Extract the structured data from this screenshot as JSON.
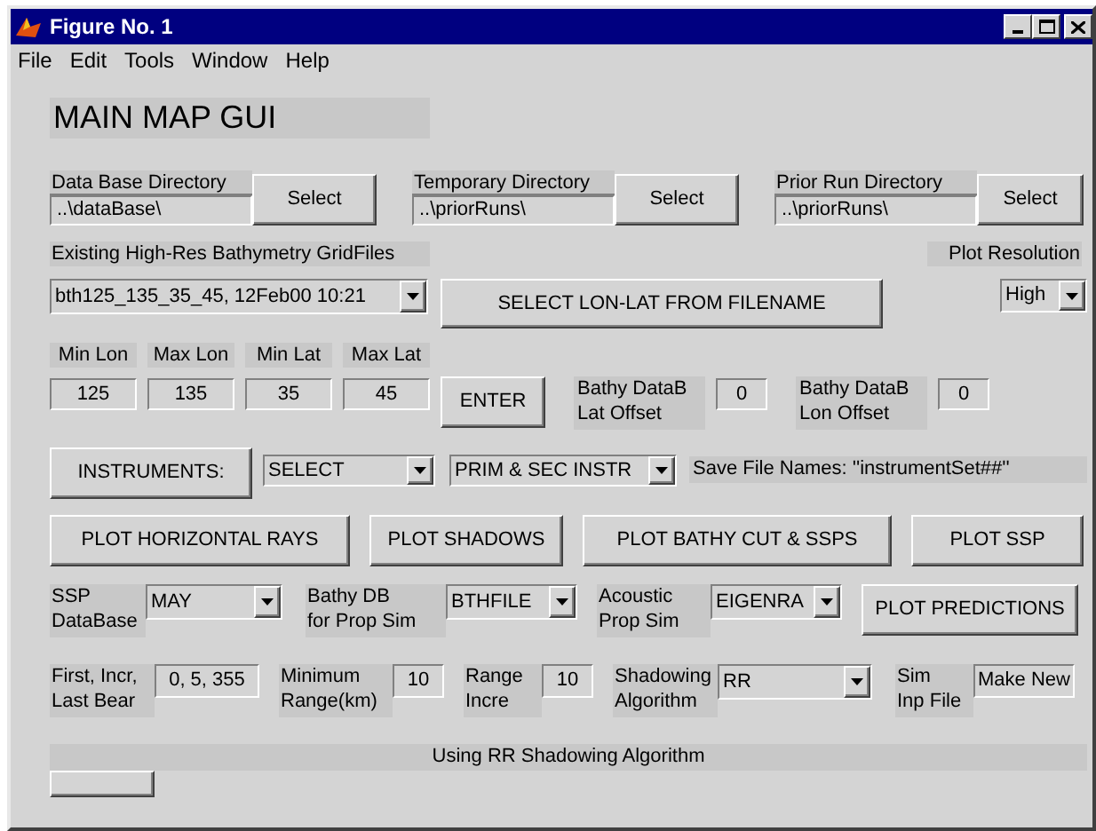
{
  "window": {
    "title": "Figure No. 1"
  },
  "menu": [
    "File",
    "Edit",
    "Tools",
    "Window",
    "Help"
  ],
  "heading": "MAIN MAP GUI",
  "directories": [
    {
      "label": "Data Base Directory",
      "value": "..\\dataBase\\",
      "button": "Select"
    },
    {
      "label": "Temporary Directory",
      "value": "..\\priorRuns\\",
      "button": "Select"
    },
    {
      "label": "Prior Run Directory",
      "value": "..\\priorRuns\\",
      "button": "Select"
    }
  ],
  "grid_files": {
    "label": "Existing High-Res Bathymetry GridFiles",
    "value": "bth125_135_35_45, 12Feb00 10:21"
  },
  "select_button": "SELECT LON-LAT FROM FILENAME",
  "plot_resolution": {
    "label": "Plot Resolution",
    "value": "High"
  },
  "bounds": [
    {
      "label": "Min Lon",
      "value": "125"
    },
    {
      "label": "Max Lon",
      "value": "135"
    },
    {
      "label": "Min Lat",
      "value": "35"
    },
    {
      "label": "Max Lat",
      "value": "45"
    }
  ],
  "enter_button": "ENTER",
  "offsets": [
    {
      "label": "Bathy DataB\nLat Offset",
      "value": "0"
    },
    {
      "label": "Bathy DataB\nLon Offset",
      "value": "0"
    }
  ],
  "instruments": {
    "button": "INSTRUMENTS:",
    "select": "SELECT",
    "mode": "PRIM & SEC INSTR",
    "save_names": "Save File Names: ''instrumentSet##''"
  },
  "plot_buttons": [
    "PLOT HORIZONTAL RAYS",
    "PLOT SHADOWS",
    "PLOT BATHY CUT & SSPS",
    "PLOT SSP"
  ],
  "sim_options": [
    {
      "label": "SSP\nDataBase",
      "value": "MAY"
    },
    {
      "label": "Bathy DB\nfor Prop Sim",
      "value": "BTHFILE"
    },
    {
      "label": "Acoustic\nProp Sim",
      "value": "EIGENRA"
    }
  ],
  "predictions_button": "PLOT PREDICTIONS",
  "parameters": [
    {
      "kind": "edit",
      "label": "First, Incr,\nLast Bear",
      "value": "0, 5, 355"
    },
    {
      "kind": "edit",
      "label": "Minimum\nRange(km)",
      "value": "10"
    },
    {
      "kind": "edit",
      "label": "Range\nIncre",
      "value": "10"
    },
    {
      "kind": "popup",
      "label": "Shadowing\nAlgorithm",
      "value": "RR"
    },
    {
      "kind": "edit",
      "label": "Sim\nInp File",
      "value": "Make New"
    }
  ],
  "status": "Using RR Shadowing Algorithm"
}
